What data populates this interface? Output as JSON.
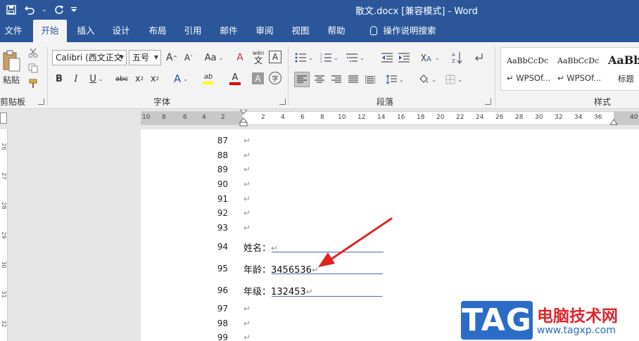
{
  "window": {
    "title": "散文.docx [兼容模式]  -  Word",
    "qat": {
      "save_icon": "save-icon",
      "undo_icon": "undo-icon",
      "redo_icon": "redo-icon",
      "customize_icon": "customize-qat-icon"
    }
  },
  "tabs": [
    "文件",
    "开始",
    "插入",
    "设计",
    "布局",
    "引用",
    "邮件",
    "审阅",
    "视图",
    "帮助",
    "操作说明搜索"
  ],
  "active_tab": "开始",
  "ribbon": {
    "clipboard": {
      "label": "剪贴板",
      "paste_label": "粘贴"
    },
    "font": {
      "label": "字体",
      "font_name": "Calibri (西文正文",
      "font_size": "五号",
      "grow": "A",
      "shrink": "A",
      "change_case": "Aa",
      "clear_format": "A",
      "phonetic_top": "wén",
      "phonetic_bottom": "文",
      "char_border": "A",
      "bold": "B",
      "italic": "I",
      "underline": "U",
      "strike": "abc",
      "subscript": "x",
      "subscript_sub": "2",
      "superscript": "x",
      "superscript_sup": "2",
      "text_effects": "A",
      "highlight": "ab",
      "font_color": "A",
      "char_shading": "A",
      "enclose_char": "字"
    },
    "paragraph": {
      "label": "段落"
    },
    "styles": {
      "label": "样式",
      "items": [
        {
          "sample": "AaBbCcDc",
          "name": "WPSOf..."
        },
        {
          "sample": "AaBbCcDc",
          "name": "WPSOf..."
        },
        {
          "sample": "AaBb",
          "name": "标题"
        }
      ]
    }
  },
  "ruler": {
    "left_numbers": [
      "10",
      "8",
      "6",
      "4",
      "2"
    ],
    "right_numbers": [
      "2",
      "4",
      "6",
      "8",
      "10",
      "12",
      "14",
      "16",
      "18",
      "20",
      "22",
      "24",
      "26",
      "28",
      "30",
      "32",
      "34",
      "36",
      "40"
    ],
    "vertical_numbers": [
      "26",
      "27",
      "28",
      "29",
      "30",
      "31",
      "32"
    ]
  },
  "document": {
    "lines": [
      "87",
      "88",
      "89",
      "90",
      "91",
      "92",
      "93",
      "94",
      "95",
      "96",
      "97",
      "98",
      "99"
    ],
    "paragraph_mark": "↵",
    "fields": [
      {
        "label": "姓名：",
        "value": ""
      },
      {
        "label": "年龄：",
        "value": "3456536"
      },
      {
        "label": "年级：",
        "value": "132453"
      }
    ]
  },
  "watermark": {
    "logo": "TAG",
    "name": "电脑技术网",
    "url": "www.tagxp.com"
  },
  "colors": {
    "brand": "#2b579a",
    "arrow": "#e02222",
    "underline": "#4a6bb0"
  }
}
